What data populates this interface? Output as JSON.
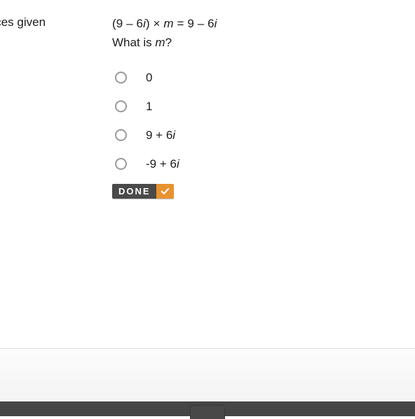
{
  "question": {
    "left_fragment": "oices given",
    "equation_parts": {
      "pre": "(9 – 6",
      "i1": "i",
      "mid": ") × ",
      "m": "m",
      "eq": " = 9 – 6",
      "i2": "i"
    },
    "prompt_pre": "What is ",
    "prompt_var": "m",
    "prompt_post": "?"
  },
  "options": [
    {
      "id": "option-0",
      "label": "0",
      "selected": false
    },
    {
      "id": "option-1",
      "label": "1",
      "selected": false
    },
    {
      "id": "option-2",
      "label_num": "9 + 6",
      "label_var": "i",
      "selected": false
    },
    {
      "id": "option-3",
      "label_num": "-9 + 6",
      "label_var": "i",
      "selected": false
    }
  ],
  "options_plain": {
    "0": "0",
    "1": "1",
    "2": "9 + 6i",
    "3": "-9 + 6i"
  },
  "done_button": {
    "label": "DONE",
    "icon": "check-icon"
  },
  "colors": {
    "page_background": "#ffffff",
    "text": "#1d1d1d",
    "radio_outline": "#9a9a9a",
    "done_background": "#4a4a4a",
    "done_accent": "#e8922f",
    "divider": "#dcdcdc",
    "footer_bar": "#454545",
    "lower_panel": "#f4f4f4"
  }
}
